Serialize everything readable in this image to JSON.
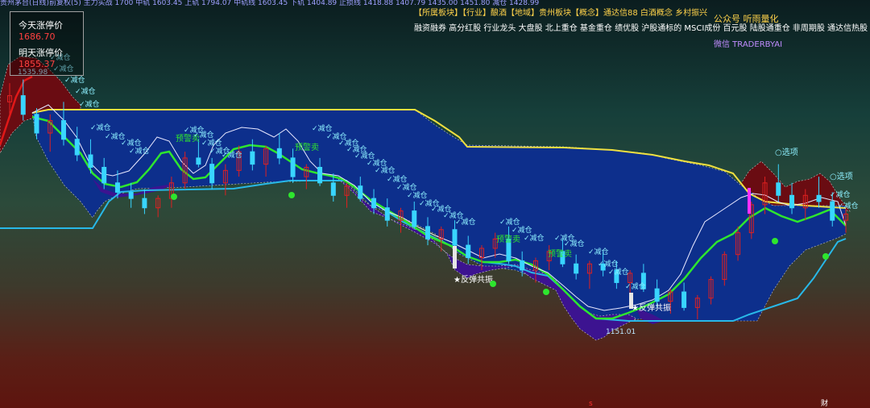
{
  "header": {
    "ticker_line": "贵州茅台(日线)前复权(5) 主力实战 1700 中轨 1603.45 上轨 1794.07 中轨线 1603.45 下轨 1404.89 止损线 1418.88 1407.79 1435.00 1451.80 减仓 1428.99"
  },
  "legend": {
    "today_label": "今天涨停价",
    "today_value": "1686.70",
    "tomorrow_label": "明天涨停价",
    "tomorrow_value": "1855.37"
  },
  "sector_tags": "【所属板块】【行业】酿酒【地域】贵州板块【概念】通达信88 白酒概念 乡村振兴",
  "concept_tags": "融资融券 高分红股 行业龙头 大盘股 北上重仓 基金重仓 绩优股 沪股通标的 MSCI成份 百元股 陆股通重仓 非周期股 通达信热股",
  "brand": "公众号 听雨量化",
  "wechat": "微信 TRADERBYAI",
  "annotations": {
    "high_price": "1535.98",
    "low_price": "1151.01",
    "rebound_1": "★反弹共振",
    "rebound_2": "★反弹共振",
    "warn_sell": "预警卖",
    "reduce": "减仓",
    "select": "○选项",
    "choose": "选"
  },
  "bottom_marks": {
    "s": "s",
    "cai": "财"
  },
  "colors": {
    "channel_fill": "#0d2f8c",
    "lower_fill": "#3c1390",
    "upper_fill": "#6a0c12",
    "yellow_line": "#f0e040",
    "cyan_line": "#28b8e8",
    "green_line": "#2ee62e",
    "white_line": "#e8e8ff",
    "red_line": "#e01818",
    "candle_up": "#e02020",
    "candle_down": "#39d5ff",
    "text_cyan": "#8ef0ff"
  },
  "chart_data": {
    "type": "candlestick",
    "title": "",
    "ylim": [
      1120,
      1560
    ],
    "series": [
      {
        "name": "",
        "kind": "candles",
        "values": [
          [
            1500,
            1530,
            1480,
            1510
          ],
          [
            1510,
            1536,
            1470,
            1480
          ],
          [
            1480,
            1490,
            1440,
            1450
          ],
          [
            1450,
            1480,
            1420,
            1470
          ],
          [
            1470,
            1500,
            1430,
            1440
          ],
          [
            1440,
            1460,
            1405,
            1415
          ],
          [
            1415,
            1440,
            1385,
            1395
          ],
          [
            1395,
            1410,
            1360,
            1370
          ],
          [
            1370,
            1390,
            1345,
            1355
          ],
          [
            1355,
            1370,
            1330,
            1345
          ],
          [
            1345,
            1360,
            1320,
            1330
          ],
          [
            1330,
            1350,
            1315,
            1345
          ],
          [
            1345,
            1380,
            1330,
            1370
          ],
          [
            1370,
            1420,
            1360,
            1410
          ],
          [
            1410,
            1440,
            1395,
            1400
          ],
          [
            1400,
            1410,
            1360,
            1370
          ],
          [
            1370,
            1400,
            1350,
            1390
          ],
          [
            1390,
            1430,
            1380,
            1420
          ],
          [
            1420,
            1440,
            1390,
            1400
          ],
          [
            1400,
            1430,
            1380,
            1425
          ],
          [
            1425,
            1450,
            1400,
            1410
          ],
          [
            1410,
            1425,
            1370,
            1380
          ],
          [
            1380,
            1400,
            1360,
            1395
          ],
          [
            1395,
            1410,
            1365,
            1370
          ],
          [
            1370,
            1385,
            1340,
            1350
          ],
          [
            1350,
            1370,
            1330,
            1365
          ],
          [
            1365,
            1380,
            1340,
            1345
          ],
          [
            1345,
            1360,
            1320,
            1330
          ],
          [
            1330,
            1345,
            1300,
            1310
          ],
          [
            1310,
            1330,
            1290,
            1325
          ],
          [
            1325,
            1340,
            1295,
            1300
          ],
          [
            1300,
            1315,
            1270,
            1280
          ],
          [
            1280,
            1300,
            1260,
            1295
          ],
          [
            1295,
            1310,
            1265,
            1270
          ],
          [
            1270,
            1285,
            1240,
            1250
          ],
          [
            1250,
            1270,
            1230,
            1265
          ],
          [
            1265,
            1290,
            1250,
            1280
          ],
          [
            1280,
            1300,
            1240,
            1245
          ],
          [
            1245,
            1260,
            1220,
            1230
          ],
          [
            1230,
            1250,
            1210,
            1245
          ],
          [
            1245,
            1270,
            1230,
            1260
          ],
          [
            1260,
            1280,
            1235,
            1240
          ],
          [
            1240,
            1255,
            1215,
            1225
          ],
          [
            1225,
            1245,
            1200,
            1240
          ],
          [
            1240,
            1260,
            1220,
            1230
          ],
          [
            1230,
            1245,
            1200,
            1210
          ],
          [
            1210,
            1230,
            1190,
            1225
          ],
          [
            1225,
            1240,
            1195,
            1200
          ],
          [
            1200,
            1215,
            1170,
            1180
          ],
          [
            1180,
            1200,
            1160,
            1195
          ],
          [
            1195,
            1210,
            1165,
            1170
          ],
          [
            1170,
            1190,
            1151,
            1185
          ],
          [
            1185,
            1220,
            1175,
            1215
          ],
          [
            1215,
            1260,
            1205,
            1255
          ],
          [
            1255,
            1300,
            1245,
            1290
          ],
          [
            1290,
            1340,
            1280,
            1335
          ],
          [
            1335,
            1380,
            1320,
            1370
          ],
          [
            1370,
            1400,
            1340,
            1350
          ],
          [
            1350,
            1370,
            1320,
            1330
          ],
          [
            1330,
            1360,
            1310,
            1350
          ],
          [
            1350,
            1380,
            1330,
            1340
          ],
          [
            1340,
            1355,
            1300,
            1310
          ],
          [
            1310,
            1330,
            1290,
            1320
          ]
        ]
      }
    ]
  }
}
